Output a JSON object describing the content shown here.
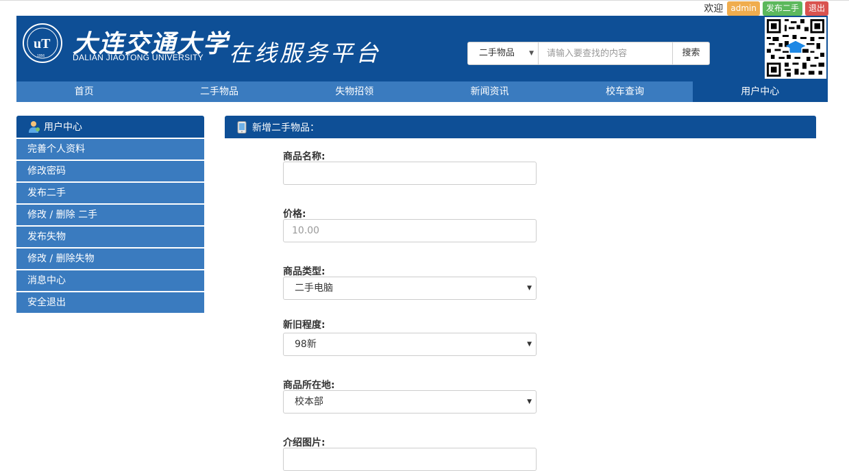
{
  "topbar": {
    "welcome": "欢迎",
    "user": "admin",
    "post_button": "发布二手",
    "logout_button": "退出"
  },
  "header": {
    "university_cn": "大连交通大学",
    "university_en": "DALIAN JIAOTONG UNIVERSITY",
    "platform": "在线服务平台",
    "seal_year": "1956"
  },
  "search": {
    "category": "二手物品",
    "placeholder": "请输入要查找的内容",
    "button": "搜索"
  },
  "nav": {
    "items": [
      "首页",
      "二手物品",
      "失物招领",
      "新闻资讯",
      "校车查询",
      "用户中心"
    ],
    "active": "用户中心"
  },
  "sidebar": {
    "title": "用户中心",
    "items": [
      "完善个人资料",
      "修改密码",
      "发布二手",
      "修改 / 删除 二手",
      "发布失物",
      "修改 / 删除失物",
      "消息中心",
      "安全退出"
    ]
  },
  "panel": {
    "title": "新增二手物品："
  },
  "form": {
    "name_label": "商品名称:",
    "name_value": "",
    "price_label": "价格:",
    "price_placeholder": "10.00",
    "type_label": "商品类型:",
    "type_value": "二手电脑",
    "condition_label": "新旧程度:",
    "condition_value": "98新",
    "location_label": "商品所在地:",
    "location_value": "校本部",
    "image_label": "介绍图片:"
  },
  "colors": {
    "header_bg": "#0e4f96",
    "nav_bg": "#3a7bbf",
    "admin_badge": "#f0ad4e",
    "post_badge": "#5cb85c",
    "logout_badge": "#d9534f"
  }
}
